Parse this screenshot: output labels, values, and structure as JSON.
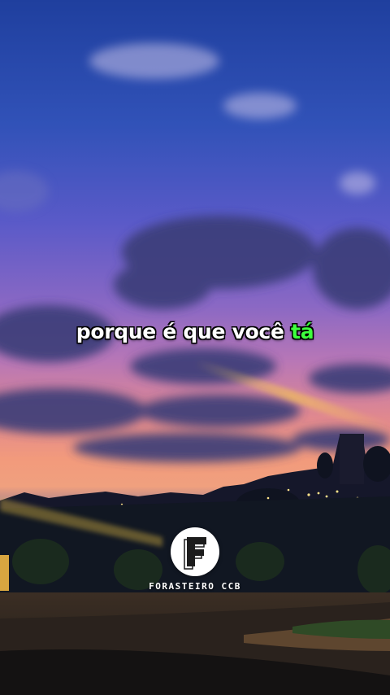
{
  "caption": {
    "text_main": "porque é que você ",
    "text_highlight": "tá",
    "highlight_color": "#3dff3d"
  },
  "brand": {
    "logo_letter": "F",
    "name": "FORASTEIRO CCB"
  }
}
